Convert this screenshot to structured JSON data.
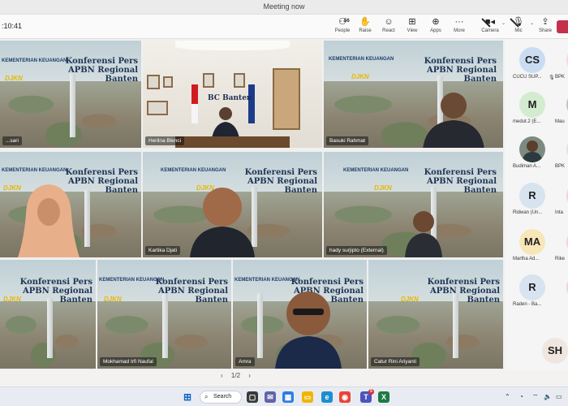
{
  "window": {
    "title": "Meeting now"
  },
  "toolbar": {
    "timer": ":10:41",
    "people_count": "56",
    "items": [
      {
        "label": "People",
        "icon": "people-icon"
      },
      {
        "label": "Raise",
        "icon": "hand-icon"
      },
      {
        "label": "React",
        "icon": "smile-icon"
      },
      {
        "label": "View",
        "icon": "grid-icon"
      },
      {
        "label": "Apps",
        "icon": "plus-icon"
      },
      {
        "label": "More",
        "icon": "ellipsis-icon"
      },
      {
        "label": "Camera",
        "icon": "camera-off-icon"
      },
      {
        "label": "Mic",
        "icon": "mic-off-icon"
      },
      {
        "label": "Share",
        "icon": "share-icon"
      }
    ]
  },
  "banner": {
    "ministry": "KEMENTERIAN KEUANGAN",
    "republic": "REPUBLIK INDONESIA",
    "title_line1": "Konferensi Pers",
    "title_line2": "APBN Regional Banten",
    "period": "Periode s.d. 31 Januari 2024",
    "brand": "DJKN"
  },
  "office": {
    "nameplate": "BC Banten"
  },
  "tiles": [
    {
      "name": "...sari"
    },
    {
      "name": "Herlina Blenci"
    },
    {
      "name": "Basuki Rahmat"
    },
    {
      "name": "Kartika Djati"
    },
    {
      "name": "hady surjipto (External)"
    },
    {
      "name": "Mokhamad Irfi Naufal"
    },
    {
      "name": "Amra"
    },
    {
      "name": "Catur Rini Ariyanti"
    }
  ],
  "pager": {
    "prev": "‹",
    "text": "1/2",
    "next": "›"
  },
  "participants": [
    {
      "initials": "CS",
      "name": "CUCU SUP...",
      "cut": "BPK",
      "color": "#c9dcf2"
    },
    {
      "initials": "M",
      "name": "medut.2 (E...",
      "cut": "Mau",
      "color": "#d3ecd0"
    },
    {
      "initials": "",
      "name": "Budiman A...",
      "cut": "BPK",
      "color": "#8c8c8c",
      "photo": true
    },
    {
      "initials": "R",
      "name": "Ridwan (Un...",
      "cut": "Inta",
      "color": "#d7e3ef"
    },
    {
      "initials": "MA",
      "name": "Martha Ad...",
      "cut": "Rike",
      "color": "#f7e6b8"
    },
    {
      "initials": "R",
      "name": "Raden - Ba...",
      "cut": "",
      "color": "#d7e3ef"
    },
    {
      "initials": "SH",
      "name": "",
      "cut": "",
      "color": "#f0e6e0"
    }
  ],
  "taskbar": {
    "search_label": "Search",
    "teams_badge": "5"
  }
}
